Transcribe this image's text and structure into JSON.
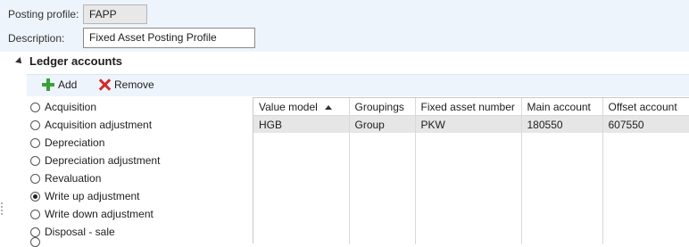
{
  "header": {
    "posting_profile_label": "Posting profile:",
    "posting_profile_value": "FAPP",
    "description_label": "Description:",
    "description_value": "Fixed Asset Posting Profile"
  },
  "section": {
    "title": "Ledger accounts"
  },
  "toolbar": {
    "add_label": "Add",
    "remove_label": "Remove"
  },
  "transaction_types": {
    "selected": "Write up adjustment",
    "items": [
      "Acquisition",
      "Acquisition adjustment",
      "Depreciation",
      "Depreciation adjustment",
      "Revaluation",
      "Write up adjustment",
      "Write down adjustment",
      "Disposal - sale"
    ]
  },
  "grid": {
    "sort_column": "Value model",
    "sort_direction": "ascending",
    "columns": [
      "Value model",
      "Groupings",
      "Fixed asset number",
      "Main account",
      "Offset account"
    ],
    "rows": [
      [
        "HGB",
        "Group",
        "PKW",
        "180550",
        "607550"
      ]
    ]
  }
}
